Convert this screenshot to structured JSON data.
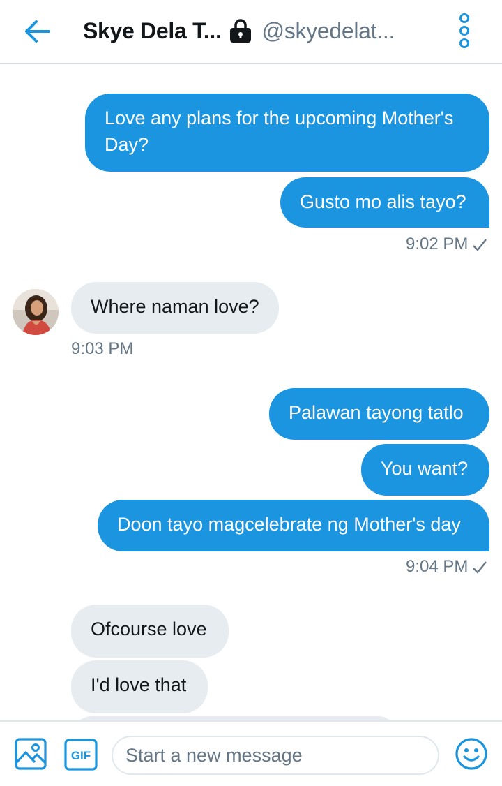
{
  "header": {
    "name": "Skye Dela T...",
    "handle": "@skyedelat..."
  },
  "messages": {
    "m1": "Love any plans for the upcoming Mother's Day?",
    "m2": "Gusto mo alis tayo?",
    "t1": "9:02 PM",
    "m3": "Where naman love?",
    "t2": "9:03 PM",
    "m4": "Palawan tayong tatlo",
    "m5": "You want?",
    "m6": "Doon tayo magcelebrate ng Mother's day",
    "t3": "9:04 PM",
    "m7": "Ofcourse love",
    "m8": "I'd love that"
  },
  "composer": {
    "placeholder": "Start a new message",
    "gif_label": "GIF"
  },
  "colors": {
    "accent": "#1b95e0",
    "incoming_bubble": "#e6ecf0"
  },
  "icons": [
    "back-arrow-icon",
    "lock-icon",
    "more-vertical-icon",
    "image-icon",
    "gif-icon",
    "emoji-icon",
    "check-icon"
  ]
}
